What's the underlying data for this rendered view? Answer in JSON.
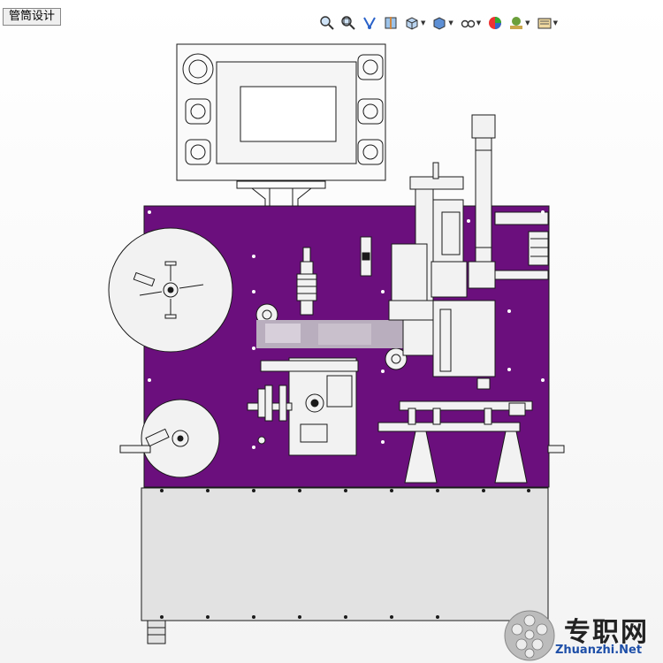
{
  "window": {
    "tab_label": "管筒设计"
  },
  "toolbar": {
    "tools": [
      {
        "name": "zoom-to-fit-icon",
        "dropdown": false
      },
      {
        "name": "zoom-area-icon",
        "dropdown": false
      },
      {
        "name": "previous-view-icon",
        "dropdown": false
      },
      {
        "name": "section-view-icon",
        "dropdown": false
      },
      {
        "name": "view-orientation-icon",
        "dropdown": true
      },
      {
        "name": "display-style-icon",
        "dropdown": true
      },
      {
        "name": "hide-show-items-icon",
        "dropdown": true
      },
      {
        "name": "edit-appearance-icon",
        "dropdown": false
      },
      {
        "name": "apply-scene-icon",
        "dropdown": true
      },
      {
        "name": "view-settings-icon",
        "dropdown": true
      }
    ]
  },
  "colors": {
    "plate": "#6b0f7d",
    "cabinet": "#e2e2e2",
    "line": "#1a1a1a",
    "part": "#f2f2f2"
  },
  "watermark": {
    "brand": "专职网",
    "url": "Zhuanzhi.Net"
  }
}
